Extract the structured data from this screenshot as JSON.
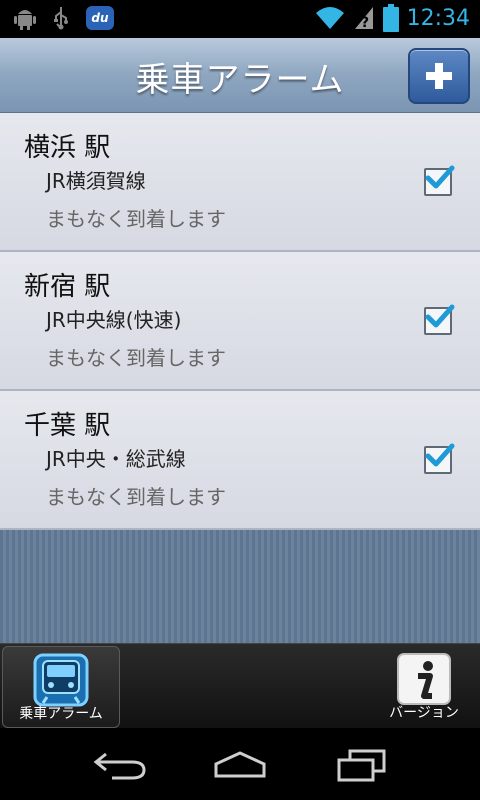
{
  "status_bar": {
    "time": "12:34",
    "icons": [
      "android-debug-icon",
      "usb-icon",
      "du-app-icon",
      "wifi-icon",
      "signal-unknown-icon",
      "battery-icon"
    ],
    "du_label": "du",
    "accent_color": "#33b5e5"
  },
  "header": {
    "title": "乗車アラーム",
    "add_button_icon": "plus-icon"
  },
  "alarms": [
    {
      "station": "横浜 駅",
      "line": "JR横須賀線",
      "status": "まもなく到着します",
      "checked": true
    },
    {
      "station": "新宿 駅",
      "line": "JR中央線(快速)",
      "status": "まもなく到着します",
      "checked": true
    },
    {
      "station": "千葉 駅",
      "line": "JR中央・総武線",
      "status": "まもなく到着します",
      "checked": true
    }
  ],
  "tabs": {
    "alarm_label": "乗車アラーム",
    "version_label": "バージョン"
  },
  "nav": {
    "icons": [
      "back-icon",
      "home-icon",
      "recent-apps-icon"
    ]
  }
}
